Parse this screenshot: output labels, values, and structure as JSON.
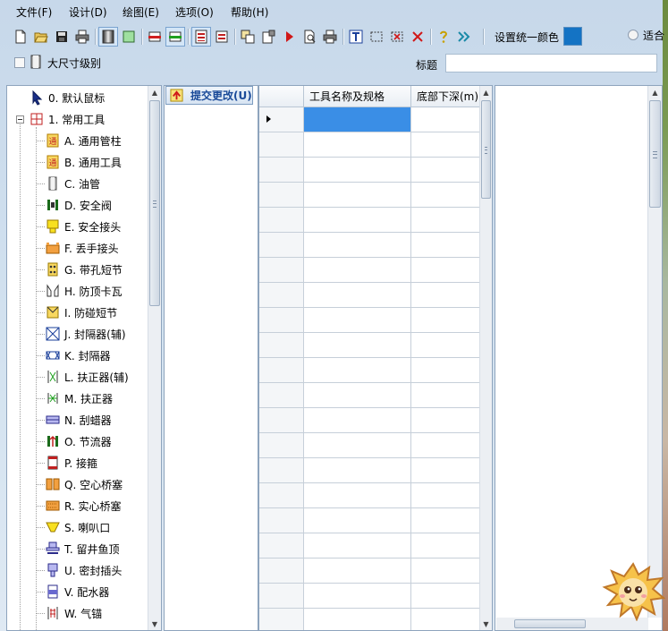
{
  "menu": [
    "文件(F)",
    "设计(D)",
    "绘图(E)",
    "选项(O)",
    "帮助(H)"
  ],
  "toolbar": {
    "buttons": [
      {
        "name": "new-file",
        "icon": "new-file-icon"
      },
      {
        "name": "open",
        "icon": "folder-open-icon"
      },
      {
        "name": "save",
        "icon": "save-icon"
      },
      {
        "name": "print",
        "icon": "printer-icon"
      },
      {
        "name": "grayscale",
        "icon": "grayscale-icon"
      },
      {
        "name": "green-fill",
        "icon": "green-fill-icon"
      },
      {
        "name": "red-line",
        "icon": "red-line-icon"
      },
      {
        "name": "green-line",
        "icon": "green-line-icon"
      },
      {
        "name": "list-view",
        "icon": "list-view-icon"
      },
      {
        "name": "red-list",
        "icon": "red-list-icon"
      },
      {
        "name": "copy-layer",
        "icon": "copy-layer-icon"
      },
      {
        "name": "paste-special",
        "icon": "paste-special-icon"
      },
      {
        "name": "run",
        "icon": "play-icon"
      },
      {
        "name": "preview",
        "icon": "print-preview-icon"
      },
      {
        "name": "print2",
        "icon": "printer-icon"
      },
      {
        "name": "text",
        "icon": "text-tool-icon"
      },
      {
        "name": "select",
        "icon": "select-rect-icon"
      },
      {
        "name": "delete-select",
        "icon": "delete-select-icon"
      },
      {
        "name": "delete",
        "icon": "close-icon"
      },
      {
        "name": "help",
        "icon": "help-icon"
      },
      {
        "name": "forward",
        "icon": "forward-icon"
      }
    ],
    "set_color_label": "设置统一颜色",
    "color": "#1473c4",
    "fit_label": "适合"
  },
  "options": {
    "big_size_label": "大尺寸级别",
    "title_label": "标题",
    "title_value": ""
  },
  "tree": {
    "default_mouse": "0. 默认鼠标",
    "common_tools": "1. 常用工具",
    "items": [
      {
        "label": "A. 通用管柱",
        "icon": "pipe-string-icon"
      },
      {
        "label": "B. 通用工具",
        "icon": "general-tool-icon"
      },
      {
        "label": "C. 油管",
        "icon": "tubing-icon"
      },
      {
        "label": "D. 安全阀",
        "icon": "safety-valve-icon"
      },
      {
        "label": "E. 安全接头",
        "icon": "safety-joint-icon"
      },
      {
        "label": "F. 丢手接头",
        "icon": "release-joint-icon"
      },
      {
        "label": "G. 带孔短节",
        "icon": "perforated-sub-icon"
      },
      {
        "label": "H. 防顶卡瓦",
        "icon": "anti-lift-slip-icon"
      },
      {
        "label": "I. 防碰短节",
        "icon": "anti-collision-sub-icon"
      },
      {
        "label": "J. 封隔器(辅)",
        "icon": "packer-aux-icon"
      },
      {
        "label": "K. 封隔器",
        "icon": "packer-icon"
      },
      {
        "label": "L. 扶正器(辅)",
        "icon": "centralizer-aux-icon"
      },
      {
        "label": "M. 扶正器",
        "icon": "centralizer-icon"
      },
      {
        "label": "N. 刮蜡器",
        "icon": "wax-scraper-icon"
      },
      {
        "label": "O. 节流器",
        "icon": "choke-icon"
      },
      {
        "label": "P. 接箍",
        "icon": "coupling-icon"
      },
      {
        "label": "Q. 空心桥塞",
        "icon": "hollow-bridge-plug-icon"
      },
      {
        "label": "R. 实心桥塞",
        "icon": "solid-bridge-plug-icon"
      },
      {
        "label": "S. 喇叭口",
        "icon": "bell-mouth-icon"
      },
      {
        "label": "T. 留井鱼顶",
        "icon": "fish-top-icon"
      },
      {
        "label": "U. 密封插头",
        "icon": "seal-plug-icon"
      },
      {
        "label": "V. 配水器",
        "icon": "water-distributor-icon"
      },
      {
        "label": "W. 气锚",
        "icon": "gas-anchor-icon"
      }
    ]
  },
  "submit": {
    "label": "提交更改(U)"
  },
  "grid": {
    "columns": [
      "工具名称及规格",
      "底部下深(m)"
    ],
    "row_count": 21
  }
}
